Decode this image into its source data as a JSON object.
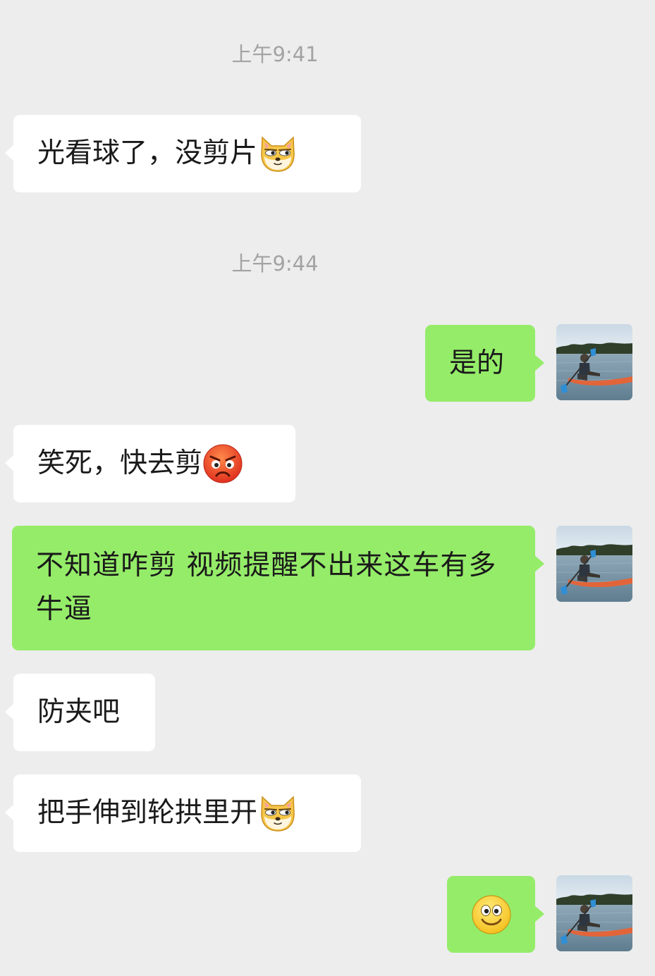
{
  "timestamps": [
    "上午9:41",
    "上午9:44"
  ],
  "messages": [
    {
      "side": "in",
      "text": "光看球了，没剪片",
      "emoji": "doge-icon"
    },
    {
      "side": "out",
      "text": "是的"
    },
    {
      "side": "in",
      "text": "笑死，快去剪",
      "emoji": "angry-face-icon"
    },
    {
      "side": "out",
      "text": "不知道咋剪 视频提醒不出来这车有多牛逼"
    },
    {
      "side": "in",
      "text": "防夹吧"
    },
    {
      "side": "in",
      "text": "把手伸到轮拱里开",
      "emoji": "doge-icon"
    },
    {
      "side": "out",
      "text": "",
      "emoji": "smile-icon"
    }
  ],
  "avatar": {
    "icon": "kayak-photo-avatar"
  },
  "colors": {
    "background": "#ededed",
    "incoming_bubble": "#ffffff",
    "outgoing_bubble": "#95ec69",
    "timestamp": "#a3a3a3"
  }
}
